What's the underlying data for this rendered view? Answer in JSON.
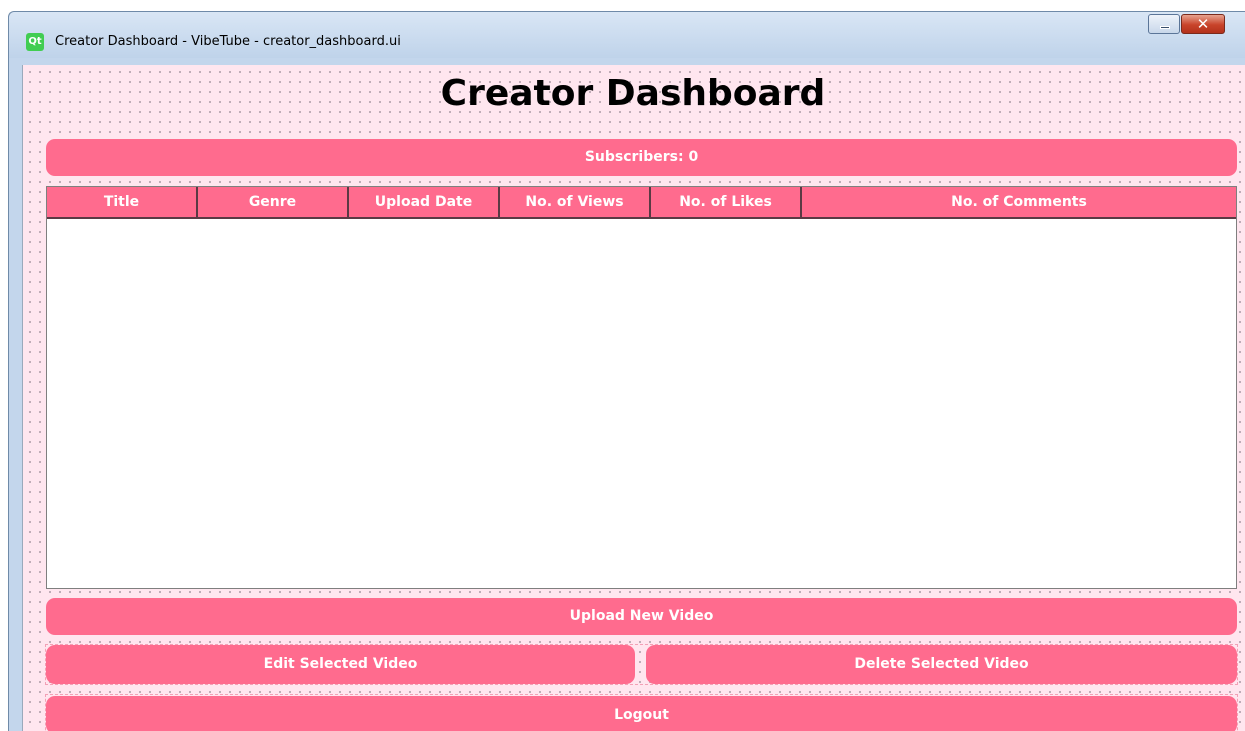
{
  "window": {
    "title": "Creator Dashboard - VibeTube - creator_dashboard.ui",
    "logo_text": "Qt",
    "minimize_glyph": "",
    "close_glyph": "✕"
  },
  "colors": {
    "accent": "#ff6b8e",
    "background": "#ffe6ef",
    "table_background": "#ffffff"
  },
  "dashboard": {
    "heading": "Creator Dashboard",
    "subscribers_label": "Subscribers: 0"
  },
  "videos_table": {
    "columns": [
      "Title",
      "Genre",
      "Upload Date",
      "No. of Views",
      "No. of Likes",
      "No. of Comments"
    ],
    "rows": []
  },
  "actions": {
    "upload_label": "Upload New Video",
    "edit_label": "Edit Selected Video",
    "delete_label": "Delete Selected Video",
    "logout_label": "Logout"
  }
}
